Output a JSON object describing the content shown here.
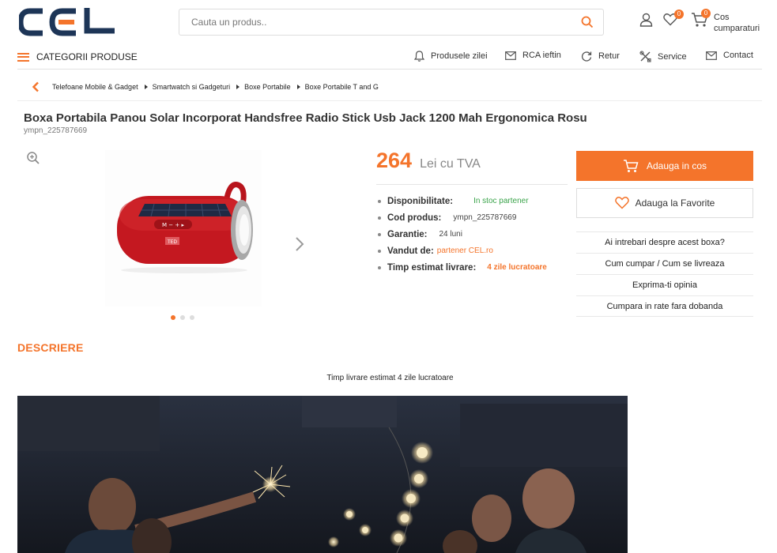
{
  "header": {
    "logo_text": "CEL",
    "search_placeholder": "Cauta un produs..",
    "favorites_count": "0",
    "cart_count": "0",
    "cart_label": "Cos cumparaturi"
  },
  "nav": {
    "categories_label": "CATEGORII PRODUSE",
    "links": [
      "Produsele zilei",
      "RCA ieftin",
      "Retur",
      "Service",
      "Contact"
    ]
  },
  "breadcrumb": [
    "Telefoane Mobile & Gadget",
    "Smartwatch si Gadgeturi",
    "Boxe Portabile",
    "Boxe Portabile T and G"
  ],
  "product": {
    "title": "Boxa Portabila Panou Solar Incorporat Handsfree Radio Stick Usb Jack 1200 Mah Ergonomica Rosu",
    "sku": "ympn_225787669",
    "price": "264",
    "currency_label": "Lei cu TVA",
    "specs": [
      {
        "key": "Disponibilitate:",
        "value": "In stoc partener"
      },
      {
        "key": "Cod produs:",
        "value": "ympn_225787669"
      },
      {
        "key": "Garantie:",
        "value": "24 luni"
      },
      {
        "key": "Vandut de:",
        "value": "partener CEL.ro"
      },
      {
        "key": "Timp estimat livrare:",
        "value": "4 zile lucratoare"
      }
    ],
    "gallery": {
      "active_index": 0,
      "total": 3,
      "speaker_brand": "TED"
    }
  },
  "actions": {
    "add_to_cart": "Adauga in cos",
    "add_to_favorites": "Adauga la Favorite",
    "links": [
      "Ai intrebari despre acest boxa?",
      "Cum cumpar / Cum se livreaza",
      "Exprima-ti opinia",
      "Cumpara in rate fara dobanda"
    ]
  },
  "description": {
    "heading": "DESCRIERE",
    "text": "Timp livrare estimat 4 zile lucratoare"
  },
  "colors": {
    "accent": "#f4742b",
    "logo_dark": "#1d3557",
    "in_stock": "#3aa34a"
  }
}
